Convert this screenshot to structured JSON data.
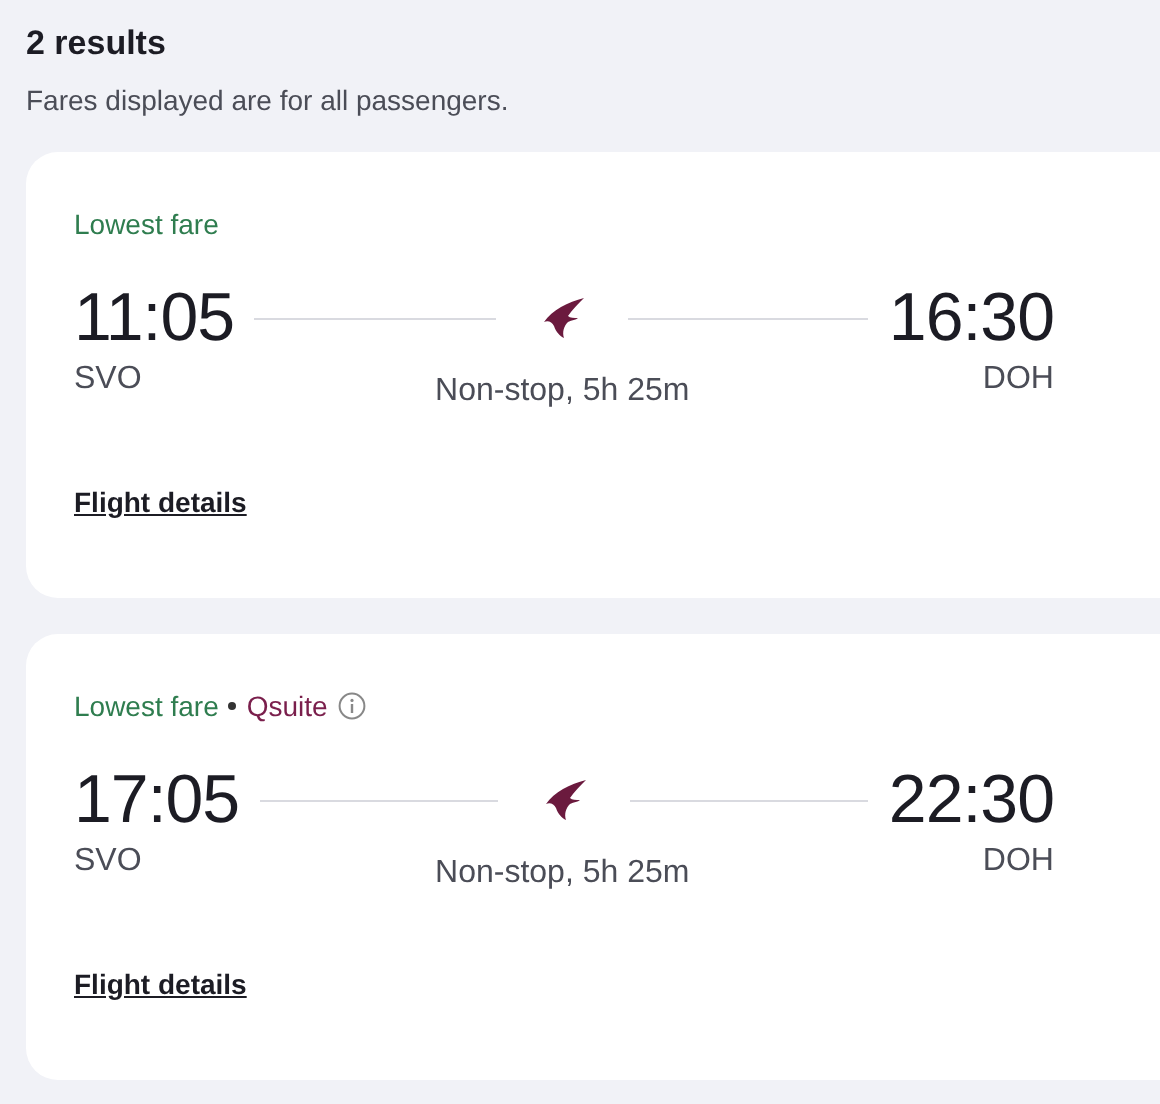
{
  "header": {
    "title": "2 results",
    "subtitle": "Fares displayed are for all passengers."
  },
  "flights": [
    {
      "tags": [
        {
          "kind": "fare",
          "text": "Lowest fare"
        }
      ],
      "departure_time": "11:05",
      "arrival_time": "16:30",
      "origin": "SVO",
      "destination": "DOH",
      "duration": "Non-stop, 5h 25m",
      "details_link": "Flight details"
    },
    {
      "tags": [
        {
          "kind": "fare",
          "text": "Lowest fare"
        },
        {
          "kind": "cabin",
          "text": "Qsuite",
          "info": true
        }
      ],
      "departure_time": "17:05",
      "arrival_time": "22:30",
      "origin": "SVO",
      "destination": "DOH",
      "duration": "Non-stop, 5h 25m",
      "details_link": "Flight details"
    }
  ]
}
